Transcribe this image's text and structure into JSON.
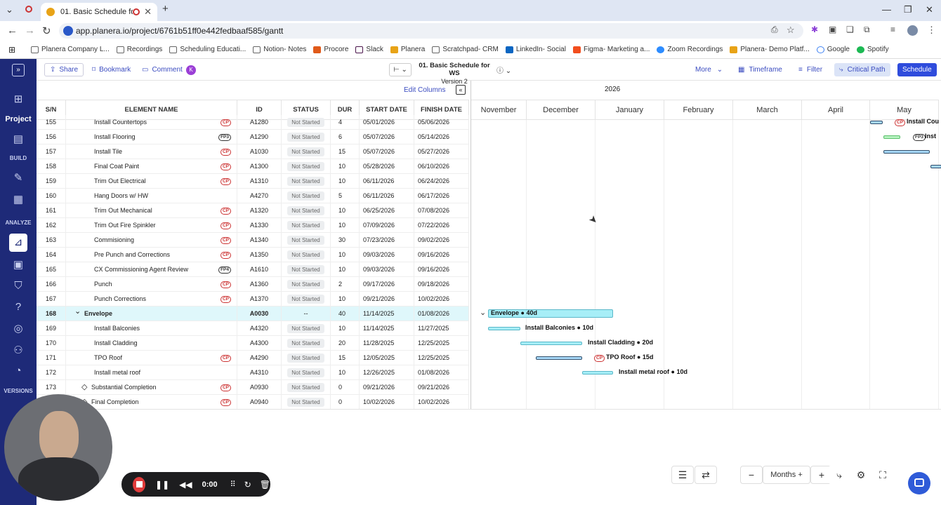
{
  "browser": {
    "tab_title": "01. Basic Schedule for WS",
    "url": "app.planera.io/project/6761b51ff0e442fedbaaf585/gantt",
    "bookmarks": [
      "Planera Company L...",
      "Recordings",
      "Scheduling Educati...",
      "Notion- Notes",
      "Procore",
      "Slack",
      "Planera",
      "Scratchpad- CRM",
      "LinkedIn- Social",
      "Figma- Marketing a...",
      "Zoom Recordings",
      "Planera- Demo Platf...",
      "Google",
      "Spotify"
    ]
  },
  "sidebar": {
    "project_label": "Project",
    "build_label": "BUILD",
    "analyze_label": "ANALYZE",
    "versions_label": "VERSIONS"
  },
  "toolbar": {
    "share": "Share",
    "bookmark": "Bookmark",
    "comment": "Comment",
    "avatar_initial": "K",
    "schedule_title": "01. Basic Schedule for WS",
    "version": "Version 2",
    "more": "More",
    "timeframe": "Timeframe",
    "filter": "Filter",
    "critical_path": "Critical Path",
    "schedule_btn": "Schedule"
  },
  "grid": {
    "edit_columns": "Edit Columns",
    "columns": [
      "S/N",
      "ELEMENT NAME",
      "ID",
      "STATUS",
      "DUR",
      "START DATE",
      "FINISH DATE"
    ],
    "rows": [
      {
        "sn": "155",
        "name": "Install Countertops",
        "tag": "CP",
        "id": "A1280",
        "status": "Not Started",
        "dur": "4",
        "start": "05/01/2026",
        "finish": "05/06/2026"
      },
      {
        "sn": "156",
        "name": "Install Flooring",
        "tag": "FP3",
        "id": "A1290",
        "status": "Not Started",
        "dur": "6",
        "start": "05/07/2026",
        "finish": "05/14/2026"
      },
      {
        "sn": "157",
        "name": "Install Tile",
        "tag": "CP",
        "id": "A1030",
        "status": "Not Started",
        "dur": "15",
        "start": "05/07/2026",
        "finish": "05/27/2026"
      },
      {
        "sn": "158",
        "name": "Final Coat Paint",
        "tag": "CP",
        "id": "A1300",
        "status": "Not Started",
        "dur": "10",
        "start": "05/28/2026",
        "finish": "06/10/2026"
      },
      {
        "sn": "159",
        "name": "Trim Out Electrical",
        "tag": "CP",
        "id": "A1310",
        "status": "Not Started",
        "dur": "10",
        "start": "06/11/2026",
        "finish": "06/24/2026"
      },
      {
        "sn": "160",
        "name": "Hang Doors w/ HW",
        "tag": "",
        "id": "A4270",
        "status": "Not Started",
        "dur": "5",
        "start": "06/11/2026",
        "finish": "06/17/2026"
      },
      {
        "sn": "161",
        "name": "Trim Out Mechanical",
        "tag": "CP",
        "id": "A1320",
        "status": "Not Started",
        "dur": "10",
        "start": "06/25/2026",
        "finish": "07/08/2026"
      },
      {
        "sn": "162",
        "name": "Trim Out Fire Spinkler",
        "tag": "CP",
        "id": "A1330",
        "status": "Not Started",
        "dur": "10",
        "start": "07/09/2026",
        "finish": "07/22/2026"
      },
      {
        "sn": "163",
        "name": "Commisioning",
        "tag": "CP",
        "id": "A1340",
        "status": "Not Started",
        "dur": "30",
        "start": "07/23/2026",
        "finish": "09/02/2026"
      },
      {
        "sn": "164",
        "name": "Pre Punch and Corrections",
        "tag": "CP",
        "id": "A1350",
        "status": "Not Started",
        "dur": "10",
        "start": "09/03/2026",
        "finish": "09/16/2026"
      },
      {
        "sn": "165",
        "name": "CX Commissioning Agent Review",
        "tag": "FP4",
        "id": "A1610",
        "status": "Not Started",
        "dur": "10",
        "start": "09/03/2026",
        "finish": "09/16/2026"
      },
      {
        "sn": "166",
        "name": "Punch",
        "tag": "CP",
        "id": "A1360",
        "status": "Not Started",
        "dur": "2",
        "start": "09/17/2026",
        "finish": "09/18/2026"
      },
      {
        "sn": "167",
        "name": "Punch Corrections",
        "tag": "CP",
        "id": "A1370",
        "status": "Not Started",
        "dur": "10",
        "start": "09/21/2026",
        "finish": "10/02/2026"
      },
      {
        "sn": "168",
        "name": "Envelope",
        "tag": "",
        "id": "A0030",
        "status": "--",
        "dur": "40",
        "start": "11/14/2025",
        "finish": "01/08/2026",
        "group": true
      },
      {
        "sn": "169",
        "name": "Install Balconies",
        "tag": "",
        "id": "A4320",
        "status": "Not Started",
        "dur": "10",
        "start": "11/14/2025",
        "finish": "11/27/2025"
      },
      {
        "sn": "170",
        "name": "Install Cladding",
        "tag": "",
        "id": "A4300",
        "status": "Not Started",
        "dur": "20",
        "start": "11/28/2025",
        "finish": "12/25/2025"
      },
      {
        "sn": "171",
        "name": "TPO Roof",
        "tag": "CP",
        "id": "A4290",
        "status": "Not Started",
        "dur": "15",
        "start": "12/05/2025",
        "finish": "12/25/2025"
      },
      {
        "sn": "172",
        "name": "Install metal roof",
        "tag": "",
        "id": "A4310",
        "status": "Not Started",
        "dur": "10",
        "start": "12/26/2025",
        "finish": "01/08/2026"
      },
      {
        "sn": "173",
        "name": "Substantial Completion",
        "tag": "CP",
        "id": "A0930",
        "status": "Not Started",
        "dur": "0",
        "start": "09/21/2026",
        "finish": "09/21/2026",
        "milestone": true
      },
      {
        "sn": "174",
        "name": "Final Completion",
        "tag": "CP",
        "id": "A0940",
        "status": "Not Started",
        "dur": "0",
        "start": "10/02/2026",
        "finish": "10/02/2026",
        "milestone": true
      }
    ]
  },
  "gantt": {
    "year": "2026",
    "months": [
      "November",
      "December",
      "January",
      "February",
      "March",
      "April",
      "May"
    ],
    "labels": {
      "envelope": "Envelope ● 40d",
      "balconies": "Install Balconies ● 10d",
      "cladding": "Install Cladding ● 20d",
      "tpo": "TPO Roof ● 15d",
      "metal": "Install metal roof ● 10d",
      "countertops": "Install Cou",
      "flooring": "Inst",
      "cp": "CP",
      "fp3": "FP3"
    }
  },
  "footer": {
    "zoom": "Months +",
    "rec_time": "0:00"
  }
}
